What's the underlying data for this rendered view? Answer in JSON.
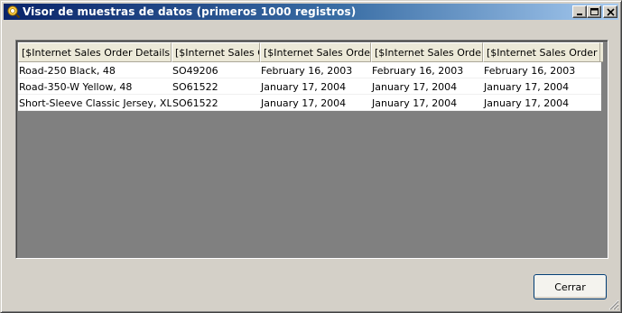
{
  "window": {
    "title": "Visor de muestras de datos (primeros 1000 registros)",
    "icon": "data-viewer-icon",
    "controls": [
      "minimize-icon",
      "maximize-icon",
      "close-icon"
    ]
  },
  "grid": {
    "columns": [
      "[$Internet Sales Order Details].[",
      "[$Internet Sales O",
      "[$Internet Sales Order",
      "[$Internet Sales Order",
      "[$Internet Sales Order D"
    ],
    "rows": [
      [
        "Road-250 Black, 48",
        "SO49206",
        "February 16, 2003",
        "February 16, 2003",
        "February 16, 2003"
      ],
      [
        "Road-350-W Yellow, 48",
        "SO61522",
        "January 17, 2004",
        "January 17, 2004",
        "January 17, 2004"
      ],
      [
        "Short-Sleeve Classic Jersey, XL",
        "SO61522",
        "January 17, 2004",
        "January 17, 2004",
        "January 17, 2004"
      ]
    ]
  },
  "footer": {
    "close_label": "Cerrar"
  },
  "colors": {
    "title_start": "#0a246a",
    "title_end": "#a6caf0",
    "face": "#d4d0c8",
    "grid_background": "#808080"
  }
}
